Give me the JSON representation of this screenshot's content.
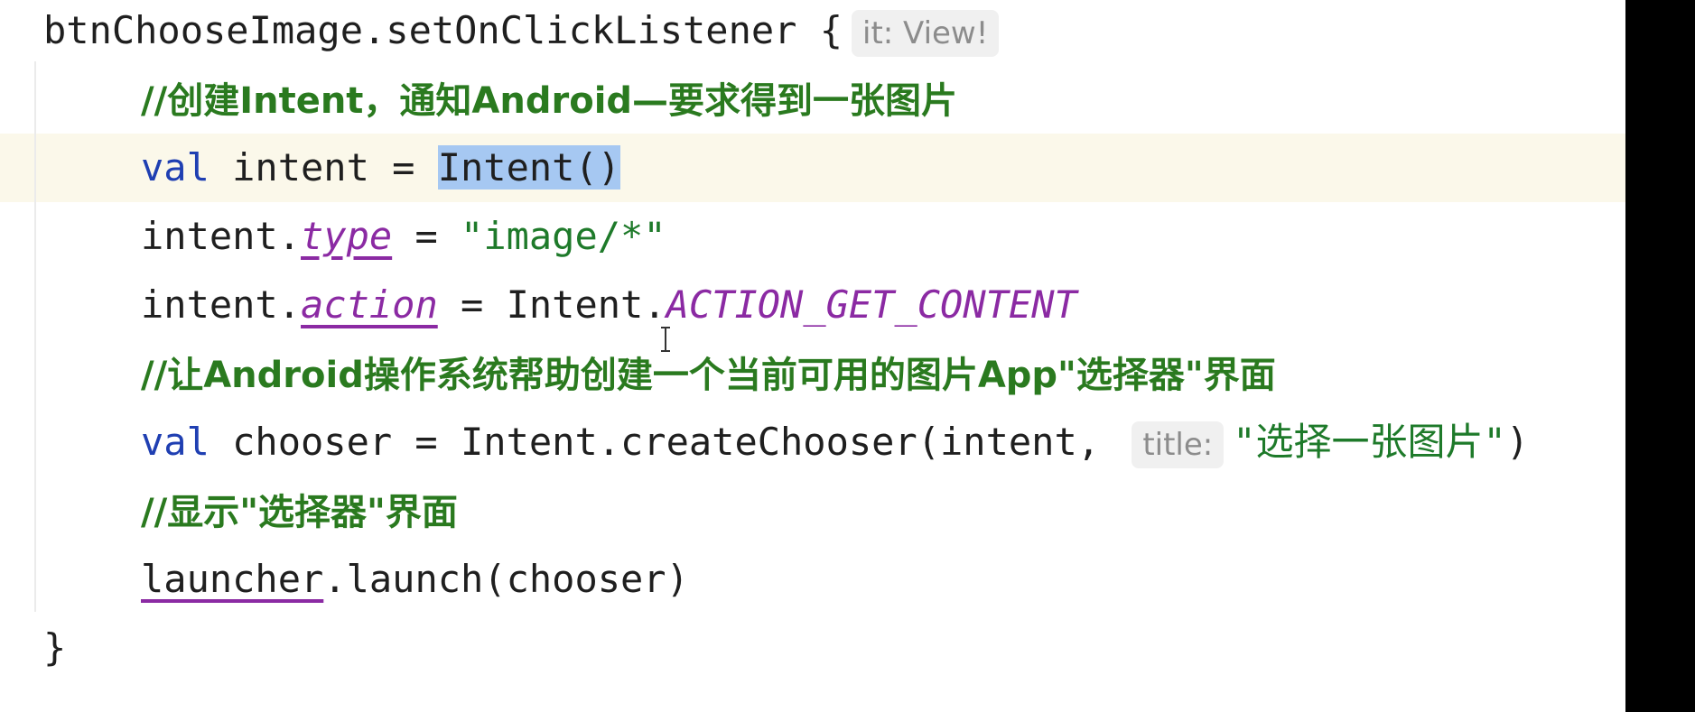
{
  "code": {
    "line1": {
      "text": "btnChooseImage.setOnClickListener {",
      "hint": "it: View!"
    },
    "line2": {
      "comment": "//创建Intent，通知Android—要求得到一张图片"
    },
    "line3": {
      "keyword": "val",
      "text": " intent = ",
      "selected": "Intent()"
    },
    "line4": {
      "prefix": "intent.",
      "prop": "type",
      "eq": " = ",
      "string": "\"image/*\""
    },
    "line5": {
      "prefix": "intent.",
      "prop": "action",
      "eq": " = Intent.",
      "const": "ACTION_GET_CONTENT"
    },
    "line6": {
      "comment": "//让Android操作系统帮助创建一个当前可用的图片App\"选择器\"界面"
    },
    "line7": {
      "keyword": "val",
      "text": " chooser = Intent.createChooser(intent, ",
      "hint": "title:",
      "string": "\"选择一张图片\"",
      "close": ")"
    },
    "line8": {
      "comment": "//显示\"选择器\"界面"
    },
    "line9": {
      "ref": "launcher",
      "text": ".launch(chooser)"
    },
    "line10": {
      "text": "}"
    }
  },
  "colors": {
    "keyword": "#1f3fb2",
    "string": "#1e7a2a",
    "comment": "#2a7a1f",
    "property": "#8b2aa3",
    "selection": "#a6c8f2",
    "caret_line": "#fbf8ea"
  }
}
